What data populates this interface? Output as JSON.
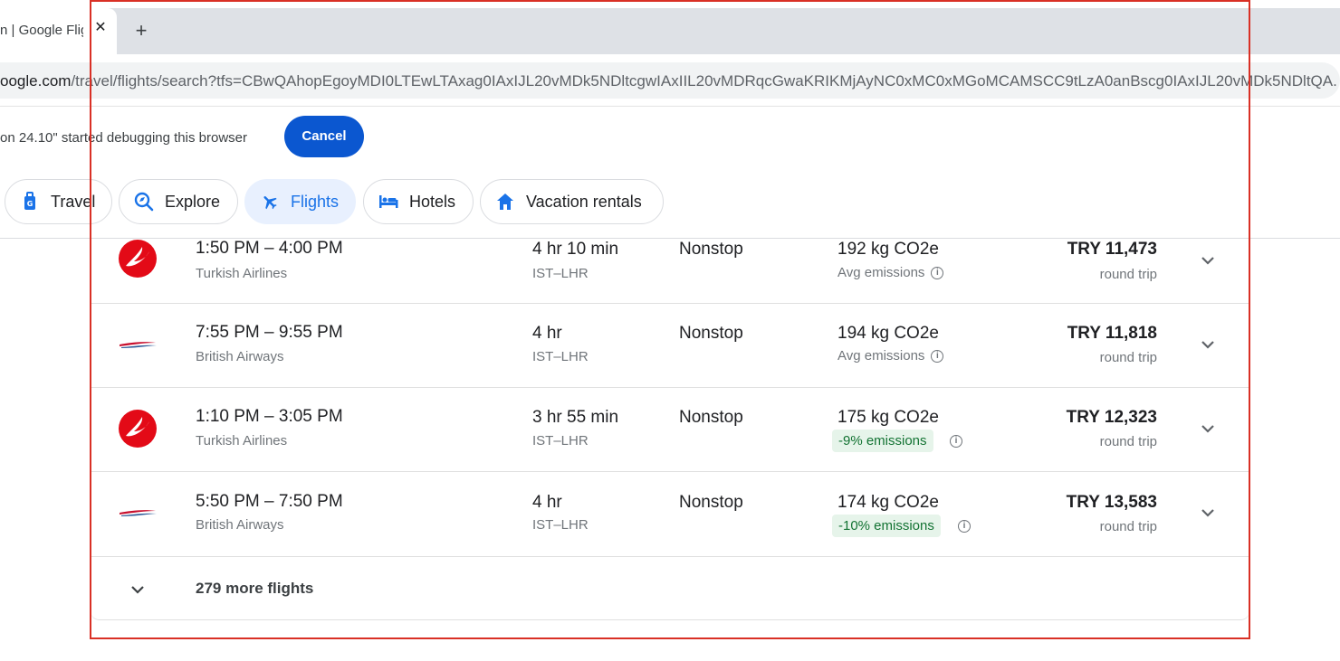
{
  "browser": {
    "tab_title": "n | Google Flig",
    "url_domain": "oogle.com",
    "url_rest": "/travel/flights/search?tfs=CBwQAhopEgoyMDI0LTEwLTAxag0IAxIJL20vMDk5NDltcgwIAxIIL20vMDRqcGwaKRIKMjAyNC0xMC0xMGoMCAMSCC9tLzA0anBscg0IAxIJL20vMDk5NDltQA...",
    "infobar_text": "on 24.10\" started debugging this browser",
    "cancel_label": "Cancel"
  },
  "nav": {
    "travel": "Travel",
    "explore": "Explore",
    "flights": "Flights",
    "hotels": "Hotels",
    "vacation_rentals": "Vacation rentals"
  },
  "flights": [
    {
      "times": "1:50 PM – 4:00 PM",
      "airline": "Turkish Airlines",
      "duration": "4 hr 10 min",
      "route": "IST–LHR",
      "stops": "Nonstop",
      "co2": "192 kg CO2e",
      "emissions": "Avg emissions",
      "price": "TRY 11,473",
      "price_note": "round trip"
    },
    {
      "times": "7:55 PM – 9:55 PM",
      "airline": "British Airways",
      "duration": "4 hr",
      "route": "IST–LHR",
      "stops": "Nonstop",
      "co2": "194 kg CO2e",
      "emissions": "Avg emissions",
      "price": "TRY 11,818",
      "price_note": "round trip"
    },
    {
      "times": "1:10 PM – 3:05 PM",
      "airline": "Turkish Airlines",
      "duration": "3 hr 55 min",
      "route": "IST–LHR",
      "stops": "Nonstop",
      "co2": "175 kg CO2e",
      "emissions": "-9% emissions",
      "price": "TRY 12,323",
      "price_note": "round trip"
    },
    {
      "times": "5:50 PM – 7:50 PM",
      "airline": "British Airways",
      "duration": "4 hr",
      "route": "IST–LHR",
      "stops": "Nonstop",
      "co2": "174 kg CO2e",
      "emissions": "-10% emissions",
      "price": "TRY 13,583",
      "price_note": "round trip"
    }
  ],
  "more_flights": "279 more flights",
  "colors": {
    "accent": "#1a73e8",
    "cancel_button": "#0b57d0",
    "turkish_red": "#e30a17",
    "ba_blue": "#2e5c99",
    "emissions_green": "#137333",
    "highlight_border": "#d93025"
  },
  "icons": {
    "travel": "luggage-icon",
    "explore": "explore-search-icon",
    "flights": "airplane-icon",
    "hotels": "bed-icon",
    "vacation": "house-icon",
    "expand": "chevron-down-icon",
    "info": "info-icon"
  }
}
